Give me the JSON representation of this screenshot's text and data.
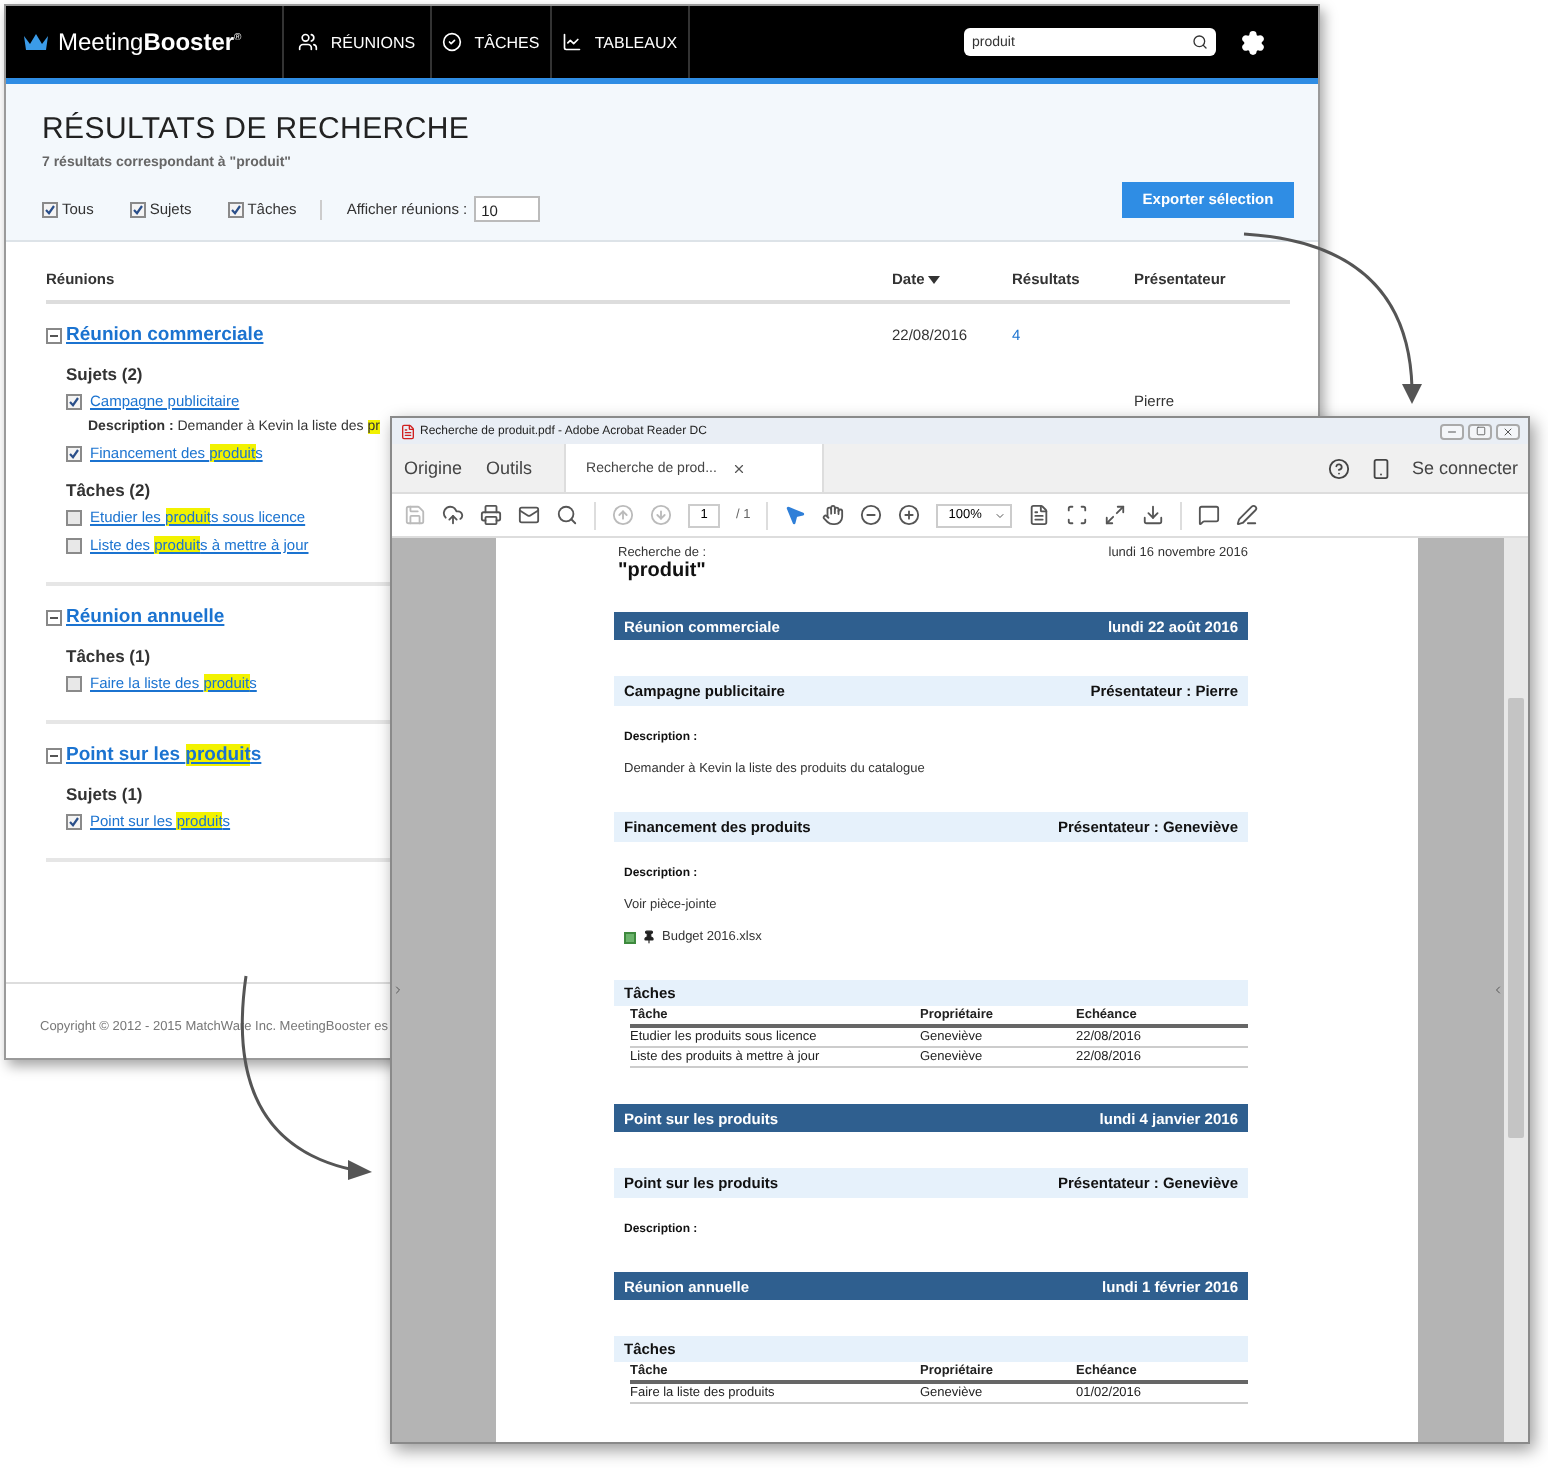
{
  "app": {
    "logo": "Meeting**Booster**$^{®}$",
    "nav": [
      {
        "label": "RÉUNIONS",
        "kind": "people"
      },
      {
        "label": "TÂCHES",
        "kind": "check"
      },
      {
        "label": "TABLEAUX",
        "kind": "chart"
      }
    ],
    "search": {
      "value": "produit"
    },
    "header": {
      "title": "RÉSULTATS DE RECHERCHE",
      "subtitle": "7 résultats correspondant à \"produit\""
    },
    "filters": [
      {
        "label": "Tous",
        "checked": true
      },
      {
        "label": "Sujets",
        "checked": true
      },
      {
        "label": "Tâches",
        "checked": true
      }
    ],
    "show_meetings": {
      "label": "Afficher réunions :",
      "value": "10"
    },
    "export_button": "Exporter sélection",
    "columns": [
      {
        "label": "Réunions",
        "sorted": false
      },
      {
        "label": "Date",
        "sorted": true
      },
      {
        "label": "Résultats",
        "sorted": false
      },
      {
        "label": "Présentateur",
        "sorted": false
      }
    ],
    "meetings": [
      {
        "expanded": true,
        "title": [
          {
            "text": "Réunion commerciale",
            "highlight": false
          }
        ],
        "date": "22/08/2016",
        "count": "4",
        "groups": [
          {
            "heading": "Sujets (2)",
            "items": [
              {
                "checked": true,
                "title": [
                  {
                    "text": "Campagne publicitaire",
                    "highlight": false
                  }
                ],
                "presenter": "Pierre",
                "description": [
                  {
                    "text": "**Description :** Demander à Kevin la liste des ",
                    "highlight": false
                  },
                  {
                    "text": "pr",
                    "highlight": true
                  }
                ]
              },
              {
                "checked": true,
                "title": [
                  {
                    "text": "Financement des ",
                    "highlight": false
                  },
                  {
                    "text": "produit",
                    "highlight": true
                  },
                  {
                    "text": "s",
                    "highlight": false
                  }
                ]
              }
            ]
          },
          {
            "heading": "Tâches (2)",
            "items": [
              {
                "checked": false,
                "title": [
                  {
                    "text": "Etudier les ",
                    "highlight": false
                  },
                  {
                    "text": "produit",
                    "highlight": true
                  },
                  {
                    "text": "s sous licence",
                    "highlight": false
                  }
                ]
              },
              {
                "checked": false,
                "title": [
                  {
                    "text": "Liste des ",
                    "highlight": false
                  },
                  {
                    "text": "produit",
                    "highlight": true
                  },
                  {
                    "text": "s à mettre à jour",
                    "highlight": false
                  }
                ]
              }
            ]
          }
        ]
      },
      {
        "expanded": true,
        "title": [
          {
            "text": "Réunion annuelle",
            "highlight": false
          }
        ],
        "groups": [
          {
            "heading": "Tâches (1)",
            "items": [
              {
                "checked": false,
                "title": [
                  {
                    "text": "Faire la liste des ",
                    "highlight": false
                  },
                  {
                    "text": "produit",
                    "highlight": true
                  },
                  {
                    "text": "s",
                    "highlight": false
                  }
                ]
              }
            ]
          }
        ]
      },
      {
        "expanded": true,
        "title": [
          {
            "text": "Point sur les ",
            "highlight": false
          },
          {
            "text": "produit",
            "highlight": true
          },
          {
            "text": "s",
            "highlight": false
          }
        ],
        "groups": [
          {
            "heading": "Sujets (1)",
            "items": [
              {
                "checked": true,
                "title": [
                  {
                    "text": "Point sur les ",
                    "highlight": false
                  },
                  {
                    "text": "produit",
                    "highlight": true
                  },
                  {
                    "text": "s",
                    "highlight": false
                  }
                ]
              }
            ]
          }
        ]
      }
    ],
    "footer": "Copyright © 2012 - 2015 MatchWare Inc. MeetingBooster es"
  },
  "reader": {
    "title": "Recherche de produit.pdf - Adobe Acrobat Reader DC",
    "tabs": [
      {
        "label": "Origine",
        "selected": false
      },
      {
        "label": "Outils",
        "selected": false
      },
      {
        "label": "Recherche de prod...",
        "selected": true
      }
    ],
    "sign_in": "Se connecter",
    "page_number": "1",
    "page_total": "/ 1",
    "zoom": "100%",
    "document": {
      "search_label": "Recherche de :",
      "query": "\"produit\"",
      "date": "lundi 16 novembre 2016",
      "sections": [
        {
          "kind": "meeting",
          "title": "Réunion commerciale",
          "date": "lundi 22 août 2016"
        },
        {
          "kind": "topic",
          "title": "Campagne publicitaire",
          "presenter": "Présentateur : Pierre"
        },
        {
          "kind": "description",
          "label": "Description :",
          "text": "Demander à Kevin la liste des produits du catalogue"
        },
        {
          "kind": "topic",
          "title": "Financement des produits",
          "presenter": "Présentateur : Geneviève"
        },
        {
          "kind": "description",
          "label": "Description :",
          "text": "Voir pièce-jointe",
          "attachment": "Budget 2016.xlsx"
        },
        {
          "kind": "tasks",
          "title": "Tâches",
          "columns": [
            "Tâche",
            "Propriétaire",
            "Echéance"
          ],
          "rows": [
            [
              "Etudier les produits sous licence",
              "Geneviève",
              "22/08/2016"
            ],
            [
              "Liste des produits à mettre à jour",
              "Geneviève",
              "22/08/2016"
            ]
          ]
        },
        {
          "kind": "meeting",
          "title": "Point sur les produits",
          "date": "lundi 4 janvier 2016"
        },
        {
          "kind": "topic",
          "title": "Point sur les produits",
          "presenter": "Présentateur : Geneviève"
        },
        {
          "kind": "description",
          "label": "Description :"
        },
        {
          "kind": "meeting",
          "title": "Réunion annuelle",
          "date": "lundi 1 février 2016"
        },
        {
          "kind": "tasks",
          "title": "Tâches",
          "columns": [
            "Tâche",
            "Propriétaire",
            "Echéance"
          ],
          "rows": [
            [
              "Faire la liste des produits",
              "Geneviève",
              "01/02/2016"
            ]
          ]
        }
      ]
    }
  }
}
